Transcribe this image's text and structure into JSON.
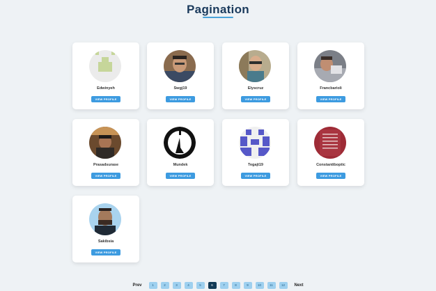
{
  "page": {
    "title": "Pagination"
  },
  "cards": [
    {
      "username": "Edwinyeh",
      "button": "VIEW PROFILE"
    },
    {
      "username": "Swgj19",
      "button": "VIEW PROFILE"
    },
    {
      "username": "Elyscruz",
      "button": "VIEW PROFILE"
    },
    {
      "username": "Francbarioli",
      "button": "VIEW PROFILE"
    },
    {
      "username": "Prasadsurase",
      "button": "VIEW PROFILE"
    },
    {
      "username": "Mundek",
      "button": "VIEW PROFILE"
    },
    {
      "username": "Tegajt19",
      "button": "VIEW PROFILE"
    },
    {
      "username": "Constantiboptic",
      "button": "VIEW PROFILE"
    },
    {
      "username": "Sakibsia",
      "button": "VIEW PROFILE"
    }
  ],
  "pagination": {
    "prev_label": "Prev",
    "next_label": "Next",
    "pages": [
      "1",
      "2",
      "3",
      "4",
      "5",
      "6",
      "7",
      "8",
      "9",
      "10",
      "11",
      "12"
    ],
    "current_page": "6"
  },
  "colors": {
    "accent": "#3d9be0",
    "page_button": "#9ed0ef",
    "page_button_active": "#123a56",
    "background": "#eef2f5"
  }
}
